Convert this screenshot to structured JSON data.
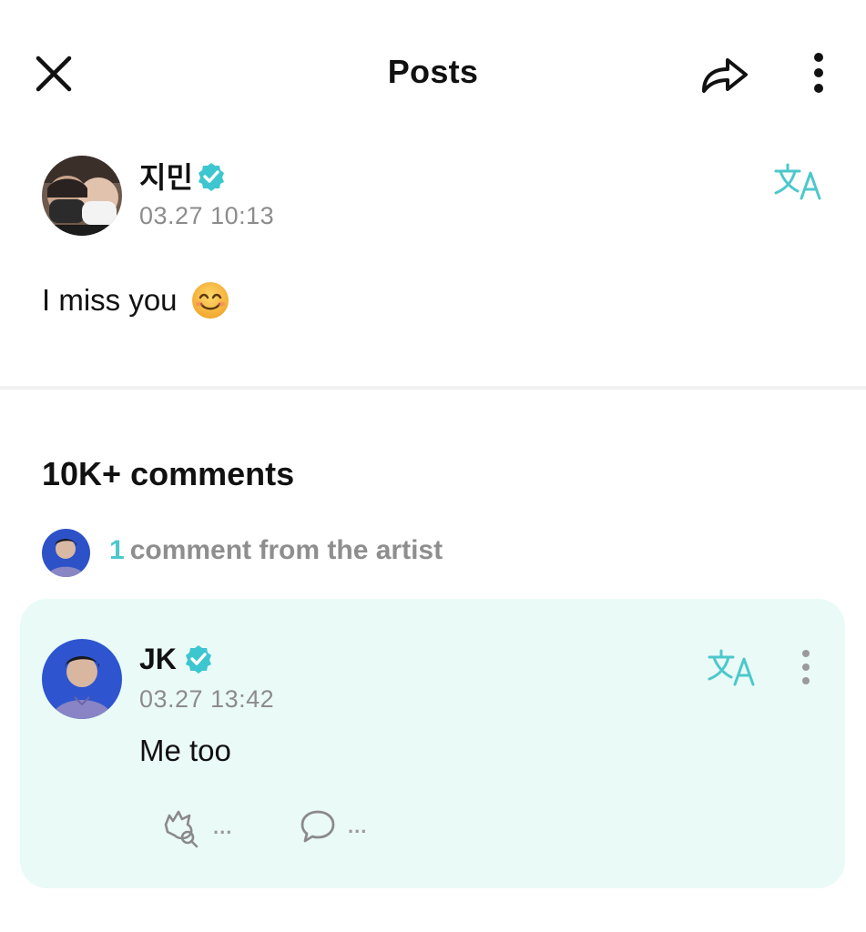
{
  "header": {
    "title": "Posts",
    "icons": {
      "close": "close-icon",
      "share": "share-icon",
      "more": "more-vertical-icon"
    }
  },
  "post": {
    "author": "지민",
    "verified": true,
    "timestamp": "03.27 10:13",
    "body": "I miss you",
    "emoji": "smiling-face-emoji",
    "translate_icon": "translate-icon"
  },
  "comments": {
    "heading": "10K+ comments",
    "artist_count": "1",
    "artist_text": "comment from the artist",
    "items": [
      {
        "author": "JK",
        "verified": true,
        "timestamp": "03.27 13:42",
        "body": "Me too",
        "like_count": "...",
        "reply_count": "..."
      }
    ]
  },
  "colors": {
    "accent": "#4cc8cc",
    "verified": "#3ec6d0",
    "card_bg": "#eafaf7",
    "meta_text": "#8c8c8c"
  }
}
